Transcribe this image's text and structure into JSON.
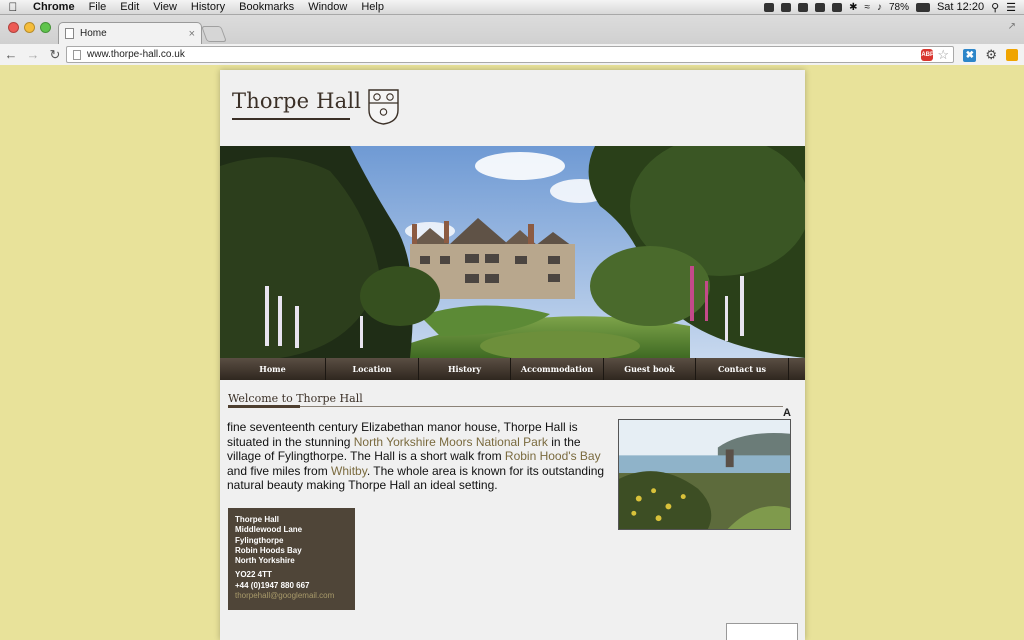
{
  "menubar": {
    "app": "Chrome",
    "items": [
      "File",
      "Edit",
      "View",
      "History",
      "Bookmarks",
      "Window",
      "Help"
    ],
    "battery": "78%",
    "clock": "Sat 12:20"
  },
  "browser": {
    "tab_title": "Home",
    "url": "www.thorpe-hall.co.uk",
    "adblock_label": "ABP"
  },
  "site": {
    "logo_text": "Thorpe Hall",
    "nav": [
      {
        "label": "Home"
      },
      {
        "label": "Location"
      },
      {
        "label": "History"
      },
      {
        "label": "Accommodation"
      },
      {
        "label": "Guest book"
      },
      {
        "label": "Contact us"
      }
    ],
    "welcome_heading": "Welcome to Thorpe Hall",
    "marker": "A",
    "intro": {
      "part1": "fine seventeenth century Elizabethan manor house, Thorpe Hall is situated in the stunning ",
      "link1": "North Yorkshire Moors National Park",
      "part2": " in the village of Fylingthorpe. The Hall is a short walk from ",
      "link2": "Robin Hood's Bay",
      "part3": " and five miles from ",
      "link3": "Whitby",
      "part4": ". The whole area is known for its outstanding natural beauty making Thorpe Hall an ideal setting."
    },
    "address": {
      "line1": "Thorpe Hall",
      "line2": "Middlewood Lane",
      "line3": "Fylingthorpe",
      "line4": "Robin Hoods Bay",
      "line5": "North Yorkshire",
      "postcode": "YO22 4TT",
      "phone": "+44 (0)1947 880 667",
      "email": "thorpehall@googlemail.com"
    }
  },
  "colors": {
    "page_background": "#e8e29a",
    "brand_brown": "#3b3027",
    "link": "#7a6a3e",
    "address_box": "#4f4538"
  }
}
